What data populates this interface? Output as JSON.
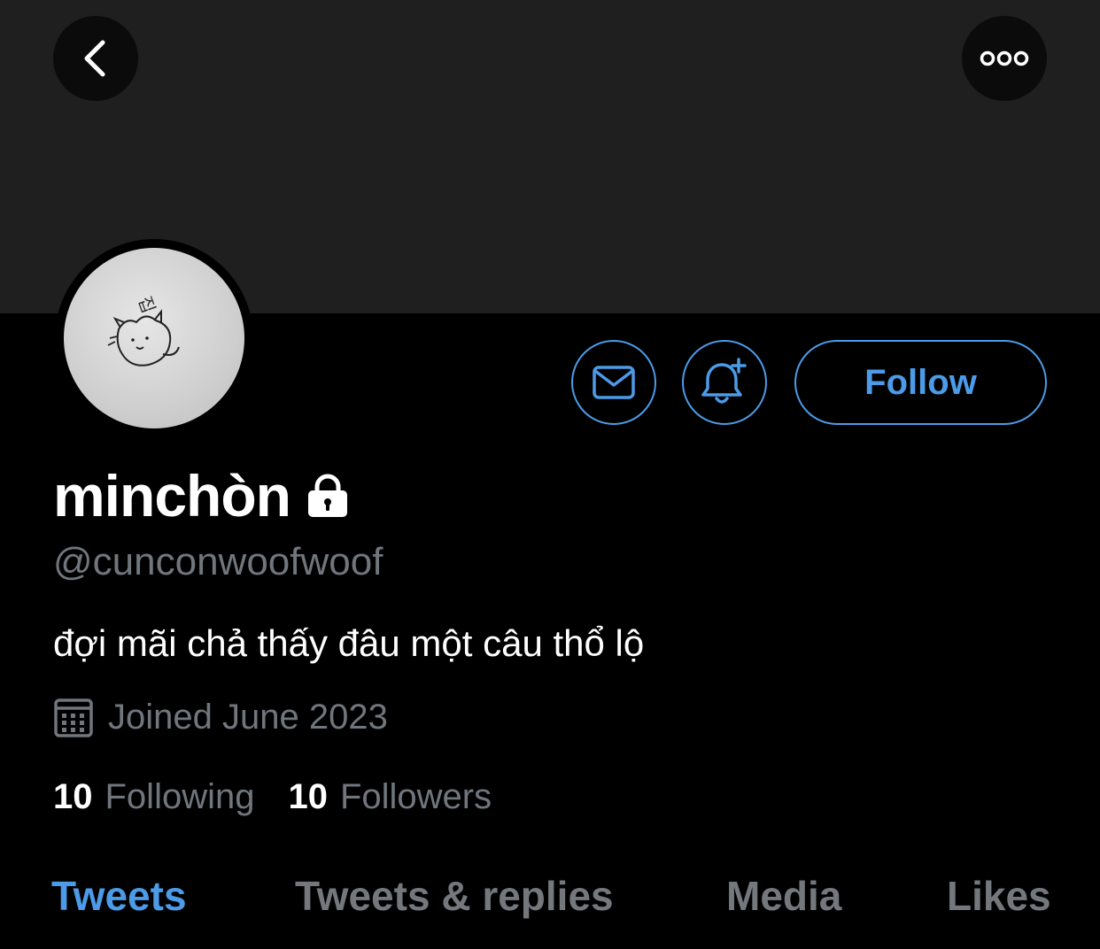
{
  "header": {
    "back_icon": "chevron-left-icon",
    "more_icon": "ellipsis-icon"
  },
  "profile": {
    "display_name": "minchòn",
    "protected_icon": "lock-icon",
    "handle": "@cunconwoofwoof",
    "bio": "đợi mãi chả thấy đâu một câu thổ lộ",
    "joined": "Joined June 2023",
    "avatar_text": "집"
  },
  "actions": {
    "message_icon": "mail-icon",
    "notify_icon": "bell-plus-icon",
    "follow_label": "Follow"
  },
  "stats": {
    "following_count": "10",
    "following_label": "Following",
    "followers_count": "10",
    "followers_label": "Followers"
  },
  "tabs": [
    {
      "label": "Tweets",
      "active": true
    },
    {
      "label": "Tweets & replies",
      "active": false
    },
    {
      "label": "Media",
      "active": false
    },
    {
      "label": "Likes",
      "active": false
    }
  ],
  "colors": {
    "accent": "#4c9be8",
    "secondary_text": "#70767c",
    "banner": "#1f1f20"
  }
}
